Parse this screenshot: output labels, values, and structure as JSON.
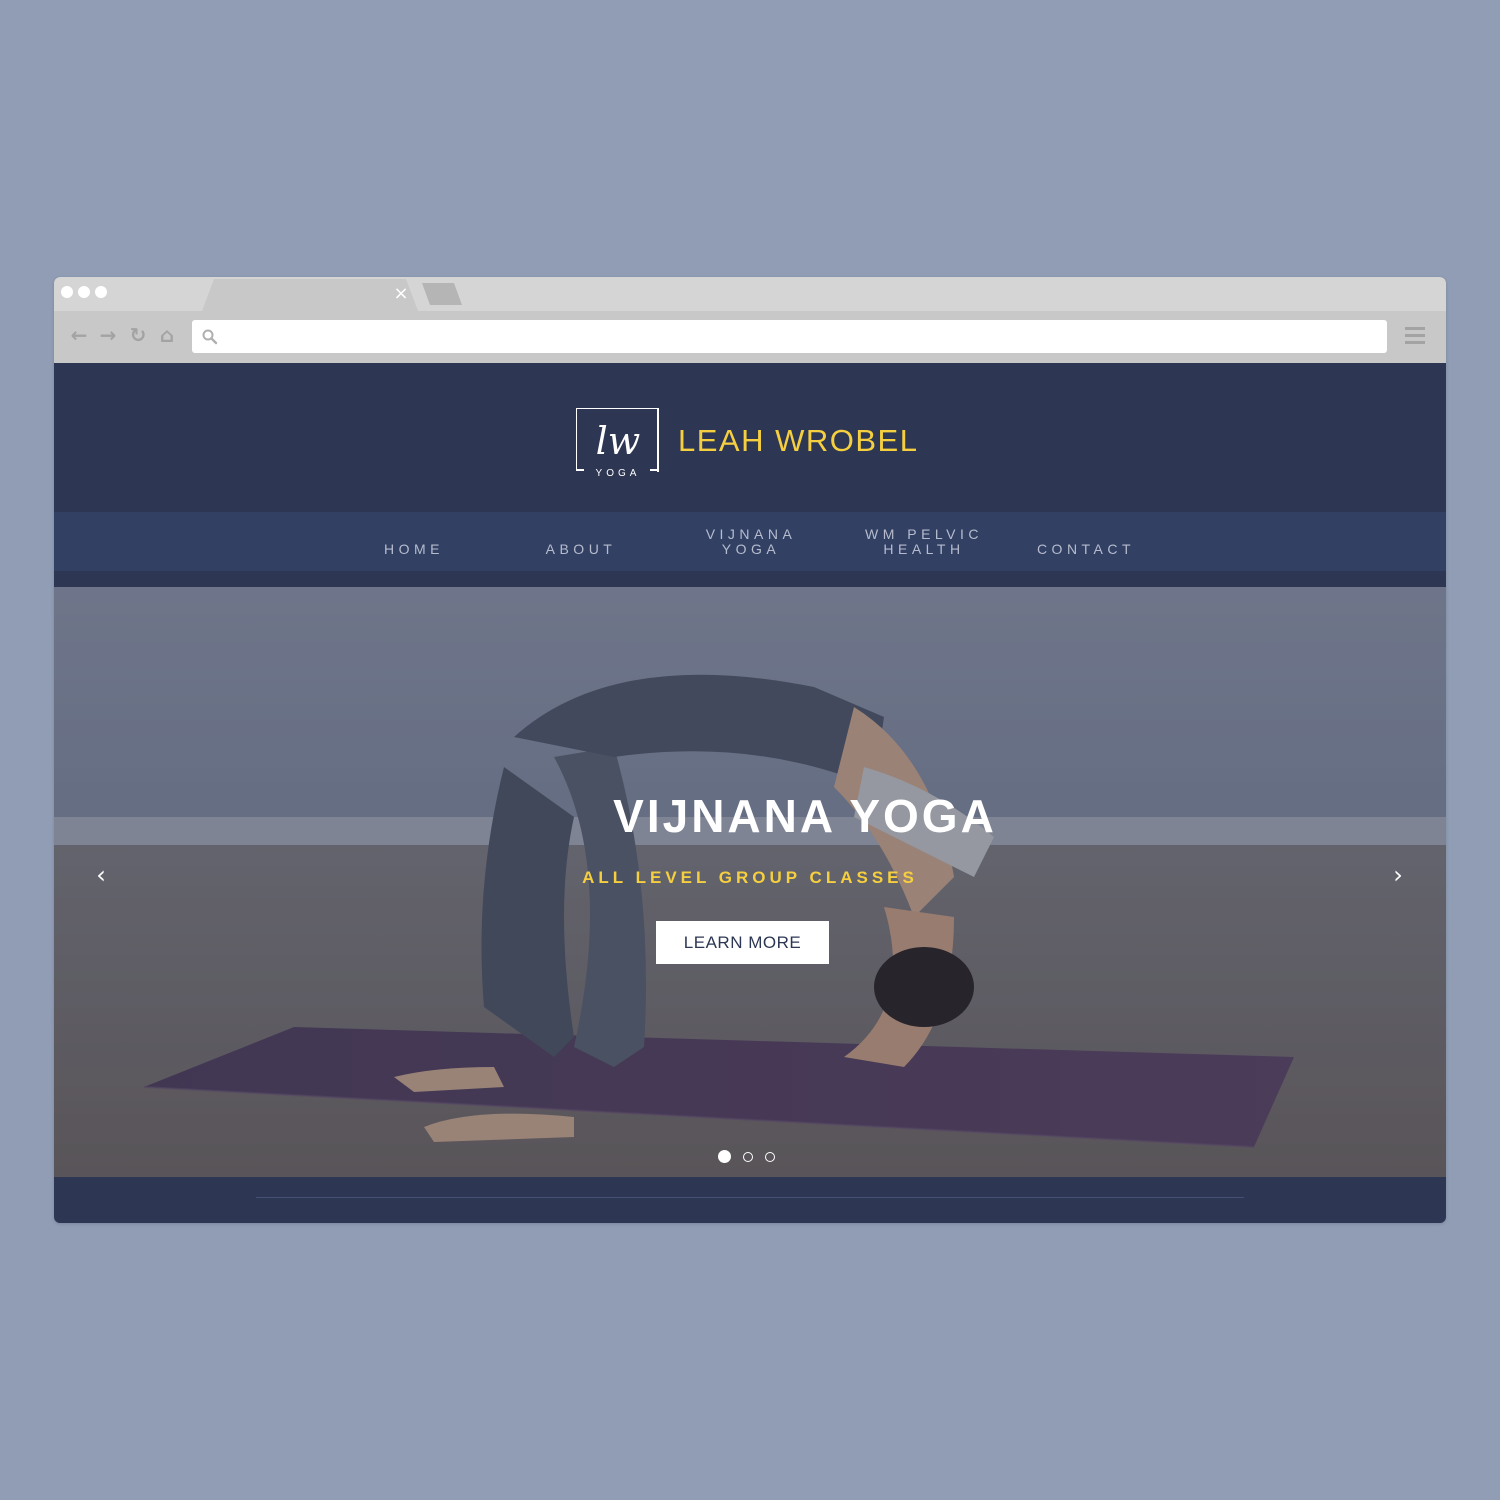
{
  "browser": {
    "tab_close": "×",
    "address_value": "",
    "nav": {
      "back": "←",
      "forward": "→",
      "reload": "↻",
      "home": "⌂"
    }
  },
  "site": {
    "logo_script": "lw",
    "logo_sub": "YOGA",
    "brand_name": "LEAH WROBEL"
  },
  "nav": {
    "home": "HOME",
    "about": "ABOUT",
    "vijnana_line1": "VIJNANA",
    "vijnana_line2": "YOGA",
    "wm_line1": "WM PELVIC",
    "wm_line2": "HEALTH",
    "contact": "CONTACT"
  },
  "hero": {
    "title": "VIJNANA YOGA",
    "subtitle": "ALL LEVEL GROUP CLASSES",
    "button": "LEARN MORE",
    "prev": "‹",
    "next": "›",
    "slide_count": 3,
    "active_slide": 1
  },
  "colors": {
    "page_bg": "#909db5",
    "header_bg": "#2d3753",
    "nav_bg": "#324064",
    "accent_yellow": "#f5cf3f",
    "nav_text": "#b6bccd"
  }
}
